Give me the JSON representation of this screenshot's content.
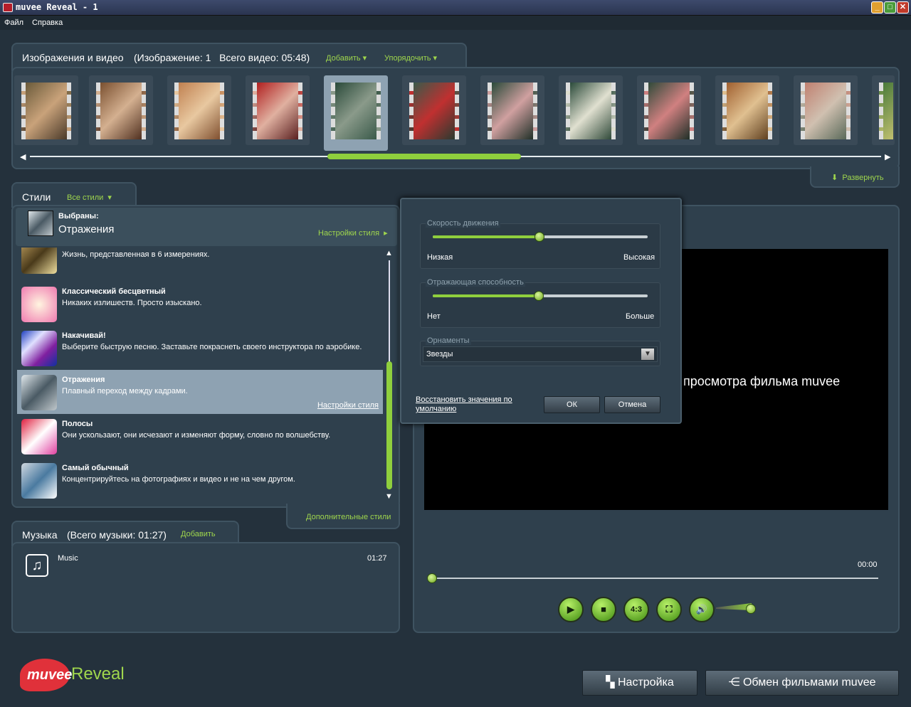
{
  "window": {
    "title": "muvee Reveal - 1",
    "min": "_",
    "max": "□",
    "close": "✕"
  },
  "menu": [
    "Файл",
    "Справка"
  ],
  "media": {
    "title": "Изображения и видео",
    "info": "(Изображение: 1   Всего видео: 05:48)",
    "add": "Добавить",
    "sort": "Упорядочить",
    "expand": "Развернуть"
  },
  "styles": {
    "title": "Стили",
    "all": "Все стили",
    "selected_label": "Выбраны:",
    "selected_name": "Отражения",
    "settings_link": "Настройки стиля",
    "more": "Дополнительные стили",
    "items": [
      {
        "name": "",
        "desc": "Жизнь, представленная в 6 измерениях."
      },
      {
        "name": "Классический бесцветный",
        "desc": "Никаких излишеств.  Просто изыскано."
      },
      {
        "name": "Накачивай!",
        "desc": "Выберите быструю песню.  Заставьте покраснеть своего инструктора по аэробике."
      },
      {
        "name": "Отражения",
        "desc": "Плавный переход между кадрами.",
        "link": "Настройки стиля"
      },
      {
        "name": "Полосы",
        "desc": "Они ускользают, они исчезают и изменяют форму, словно по волшебству."
      },
      {
        "name": "Самый обычный",
        "desc": "Концентрируйтесь на фотографиях и видео и не на чем другом."
      }
    ]
  },
  "dialog": {
    "speed_label": "Скорость движения",
    "speed_low": "Низкая",
    "speed_high": "Высокая",
    "speed_value": 0.5,
    "refl_label": "Отражающая способность",
    "refl_low": "Нет",
    "refl_high": "Больше",
    "refl_value": 0.5,
    "orn_label": "Орнаменты",
    "orn_value": "Звезды",
    "restore": "Восстановить значения по умолчанию",
    "ok": "ОК",
    "cancel": "Отмена"
  },
  "music": {
    "title": "Музыка",
    "info": "(Всего музыки: 01:27)",
    "add": "Добавить",
    "track": "Music",
    "duration": "01:27"
  },
  "preview": {
    "text": "просмотра фильма muvee",
    "time": "00:00",
    "ratio": "4:3"
  },
  "logo": {
    "a": "muvee",
    "b": "Reveal"
  },
  "bottom": {
    "settings": "Настройка",
    "share": "Обмен фильмами muvee"
  }
}
